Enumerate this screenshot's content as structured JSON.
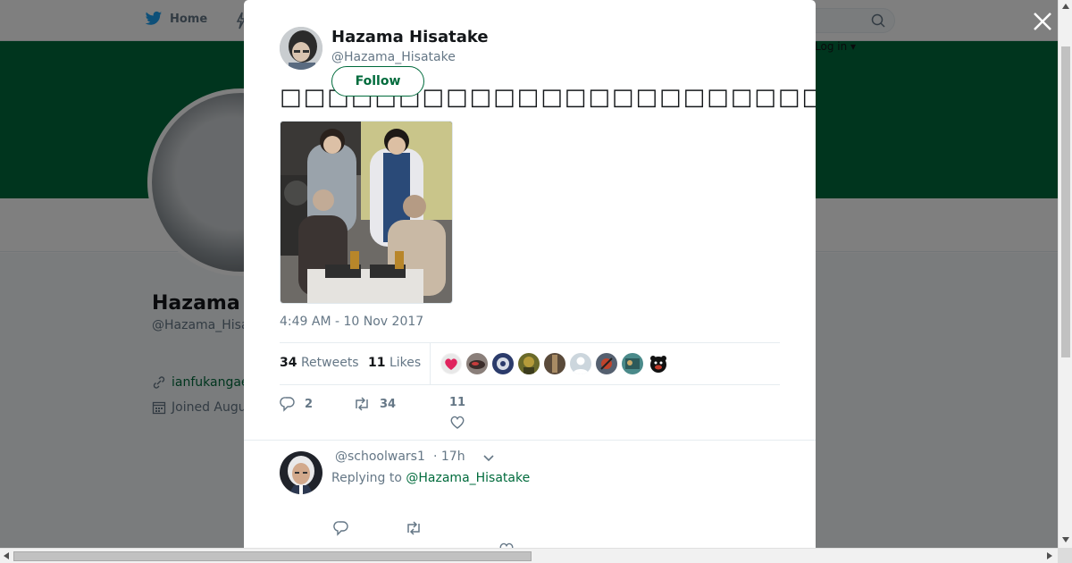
{
  "nav": {
    "home_label": "Home",
    "login_label": "Log in ▾"
  },
  "profile": {
    "name": "Hazama",
    "handle": "@Hazama_Hisa",
    "link": "ianfukangae",
    "joined": "Joined Augu"
  },
  "tweet": {
    "author_name": "Hazama Hisatake",
    "author_handle": "@Hazama_Hisatake",
    "follow_label": "Follow",
    "text": "□□□□□□□□□□□□□□□□□□□□□□□□□□□□□□□□□□□□□□□□□□□□□□",
    "timestamp": "4:49 AM - 10 Nov 2017",
    "retweets_count": "34",
    "retweets_label": "Retweets",
    "likes_count": "11",
    "likes_label": "Likes",
    "replies_action_count": "2",
    "retweets_action_count": "34",
    "likes_action_count": "11"
  },
  "reply": {
    "handle": "@schoolwars1",
    "time": "· 17h",
    "replying_prefix": "Replying to",
    "replying_to": "@Hazama_Hisatake"
  },
  "colors": {
    "brand": "#006b3c",
    "banner": "#006b3c",
    "like": "#e0245e"
  }
}
